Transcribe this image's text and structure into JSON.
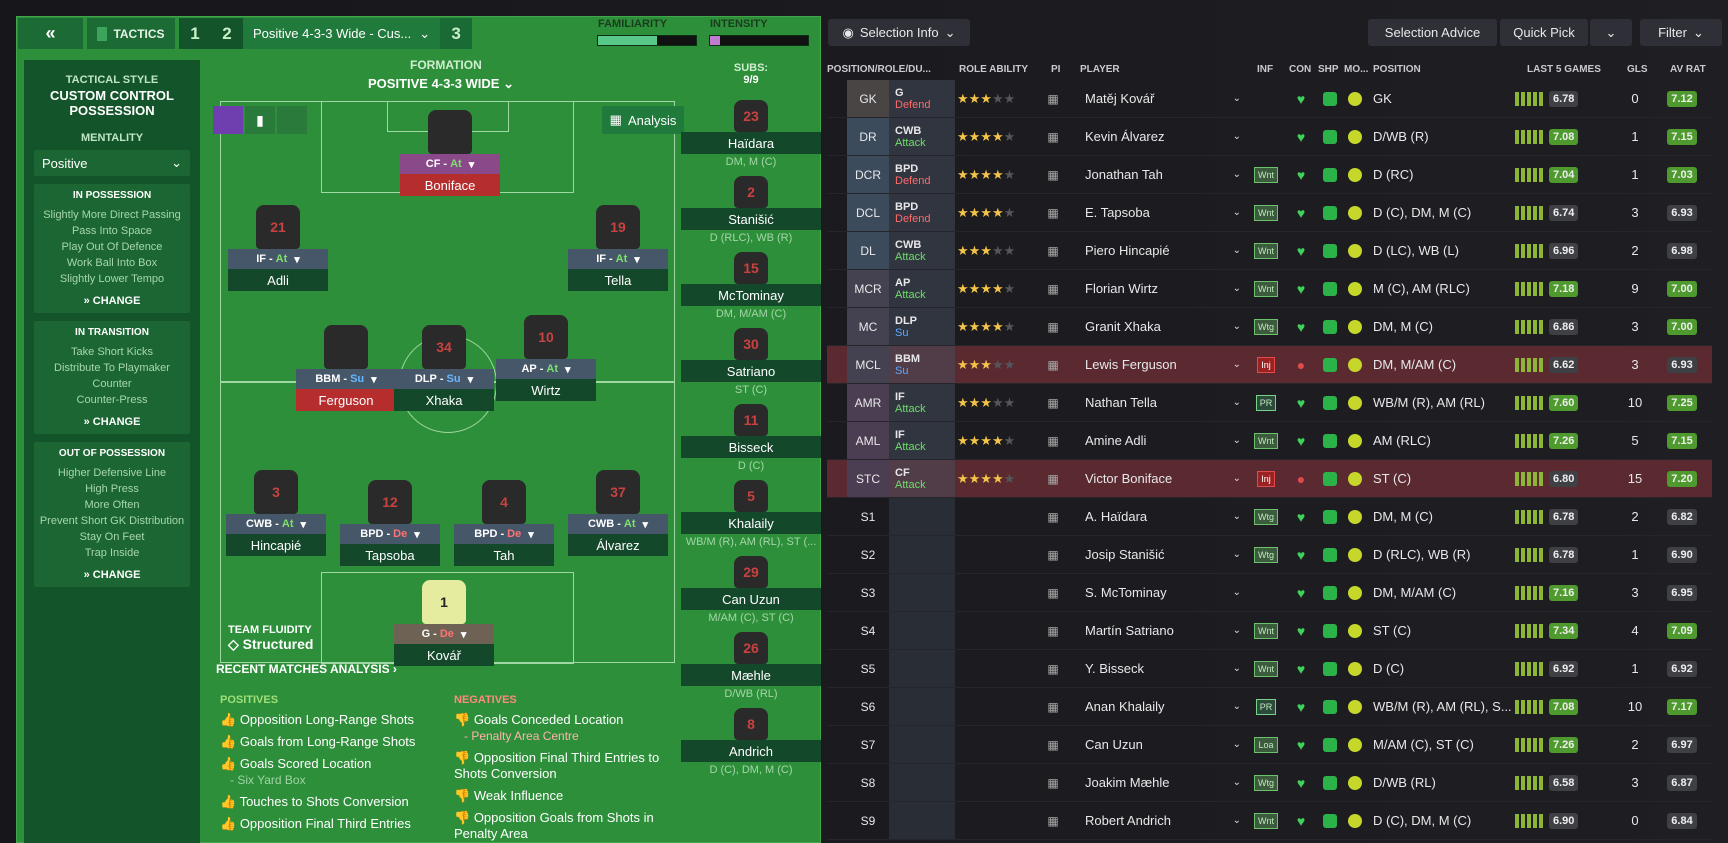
{
  "header": {
    "tactics_label": "TACTICS",
    "tab1": "1",
    "tab2": "2",
    "tab3": "3",
    "tactic_name": "Positive 4-3-3 Wide - Cus...",
    "familiarity": "FAMILIARITY",
    "intensity": "INTENSITY",
    "familiarity_level": 0.6,
    "intensity_level": 0.1
  },
  "left": {
    "tactical_style_heading": "TACTICAL STYLE",
    "tactical_style": "CUSTOM CONTROL POSSESSION",
    "mentality_heading": "MENTALITY",
    "mentality": "Positive",
    "in_possession": {
      "title": "IN POSSESSION",
      "items": [
        "Slightly More Direct Passing",
        "Pass Into Space",
        "Play Out Of Defence",
        "Work Ball Into Box",
        "Slightly Lower Tempo"
      ],
      "change": "CHANGE"
    },
    "in_transition": {
      "title": "IN TRANSITION",
      "items": [
        "Take Short Kicks",
        "Distribute To Playmaker",
        "Counter",
        "Counter-Press"
      ],
      "change": "CHANGE"
    },
    "out_of_possession": {
      "title": "OUT OF POSSESSION",
      "items": [
        "Higher Defensive Line",
        "High Press",
        "More Often",
        "Prevent Short GK Distribution",
        "Stay On Feet",
        "Trap Inside"
      ],
      "change": "CHANGE"
    }
  },
  "formation": {
    "heading": "FORMATION",
    "name": "POSITIVE 4-3-3 WIDE",
    "analysis_btn": "Analysis",
    "fluidity_heading": "TEAM FLUIDITY",
    "fluidity": "Structured"
  },
  "pitch_players": [
    {
      "num": "",
      "role": "CF",
      "duty": "At",
      "name": "Boniface",
      "inj": true,
      "gk": false
    },
    {
      "num": "21",
      "role": "IF",
      "duty": "At",
      "name": "Adli",
      "inj": false
    },
    {
      "num": "19",
      "role": "IF",
      "duty": "At",
      "name": "Tella",
      "inj": false
    },
    {
      "num": "",
      "role": "BBM",
      "duty": "Su",
      "name": "Ferguson",
      "inj": true
    },
    {
      "num": "34",
      "role": "DLP",
      "duty": "Su",
      "name": "Xhaka",
      "inj": false
    },
    {
      "num": "10",
      "role": "AP",
      "duty": "At",
      "name": "Wirtz",
      "inj": false
    },
    {
      "num": "3",
      "role": "CWB",
      "duty": "At",
      "name": "Hincapié",
      "inj": false
    },
    {
      "num": "12",
      "role": "BPD",
      "duty": "De",
      "name": "Tapsoba",
      "inj": false
    },
    {
      "num": "4",
      "role": "BPD",
      "duty": "De",
      "name": "Tah",
      "inj": false
    },
    {
      "num": "37",
      "role": "CWB",
      "duty": "At",
      "name": "Álvarez",
      "inj": false
    },
    {
      "num": "1",
      "role": "G",
      "duty": "De",
      "name": "Kovář",
      "inj": false
    }
  ],
  "subs": {
    "heading": "SUBS:",
    "count": "9/9",
    "list": [
      {
        "num": "23",
        "name": "Haïdara",
        "pos": "DM, M (C)"
      },
      {
        "num": "2",
        "name": "Stanišić",
        "pos": "D (RLC), WB (R)"
      },
      {
        "num": "15",
        "name": "McTominay",
        "pos": "DM, M/AM (C)"
      },
      {
        "num": "30",
        "name": "Satriano",
        "pos": "ST (C)"
      },
      {
        "num": "11",
        "name": "Bisseck",
        "pos": "D (C)"
      },
      {
        "num": "5",
        "name": "Khalaily",
        "pos": "WB/M (R), AM (RL), ST (..."
      },
      {
        "num": "29",
        "name": "Can Uzun",
        "pos": "M/AM (C), ST (C)"
      },
      {
        "num": "26",
        "name": "Mæhle",
        "pos": "D/WB (RL)"
      },
      {
        "num": "8",
        "name": "Andrich",
        "pos": "D (C), DM, M (C)"
      }
    ]
  },
  "analysis": {
    "heading": "RECENT MATCHES ANALYSIS",
    "positives_heading": "POSITIVES",
    "negatives_heading": "NEGATIVES",
    "positives": [
      "Opposition Long-Range Shots",
      "Goals from Long-Range Shots",
      "Goals Scored Location",
      "Touches to Shots Conversion",
      "Opposition Final Third Entries"
    ],
    "positive_sub": "- Six Yard Box",
    "negatives": [
      "Goals Conceded Location",
      "Opposition Final Third Entries to Shots Conversion",
      "Weak Influence",
      "Opposition Goals from Shots in Penalty Area"
    ],
    "negative_sub": "- Penalty Area Centre"
  },
  "right": {
    "selection_info": "Selection Info",
    "selection_advice": "Selection Advice",
    "quick_pick": "Quick Pick",
    "filter": "Filter",
    "columns": {
      "pos": "POSITION/ROLE/DU...",
      "ability": "ROLE ABILITY",
      "pi": "PI",
      "player": "PLAYER",
      "inf": "INF",
      "con": "CON",
      "shp": "SHP",
      "mo": "MO...",
      "position": "POSITION",
      "last5": "LAST 5 GAMES",
      "gls": "GLS",
      "avrat": "AV RAT"
    },
    "rows": [
      {
        "slot": "GK",
        "role": "G",
        "duty": "Defend",
        "stars": "2.5",
        "player": "Matěj Kovář",
        "inf": "",
        "position": "GK",
        "last": "6.78",
        "gls": "0",
        "av": "7.12"
      },
      {
        "slot": "DR",
        "role": "CWB",
        "duty": "Attack",
        "stars": "3.5",
        "player": "Kevin Álvarez",
        "inf": "",
        "position": "D/WB (R)",
        "last": "7.08",
        "gls": "1",
        "av": "7.15"
      },
      {
        "slot": "DCR",
        "role": "BPD",
        "duty": "Defend",
        "stars": "3.5",
        "player": "Jonathan Tah",
        "inf": "Wnt",
        "position": "D (RC)",
        "last": "7.04",
        "gls": "1",
        "av": "7.03"
      },
      {
        "slot": "DCL",
        "role": "BPD",
        "duty": "Defend",
        "stars": "3.5",
        "player": "E. Tapsoba",
        "inf": "Wnt",
        "position": "D (C), DM, M (C)",
        "last": "6.74",
        "gls": "3",
        "av": "6.93"
      },
      {
        "slot": "DL",
        "role": "CWB",
        "duty": "Attack",
        "stars": "2.5",
        "player": "Piero Hincapié",
        "inf": "Wnt",
        "position": "D (LC), WB (L)",
        "last": "6.96",
        "gls": "2",
        "av": "6.98"
      },
      {
        "slot": "MCR",
        "role": "AP",
        "duty": "Attack",
        "stars": "4",
        "player": "Florian Wirtz",
        "inf": "Wnt",
        "position": "M (C), AM (RLC)",
        "last": "7.18",
        "gls": "9",
        "av": "7.00"
      },
      {
        "slot": "MC",
        "role": "DLP",
        "duty": "Su",
        "stars": "3.5",
        "player": "Granit Xhaka",
        "inf": "Wtg",
        "position": "DM, M (C)",
        "last": "6.86",
        "gls": "3",
        "av": "7.00"
      },
      {
        "slot": "MCL",
        "role": "BBM",
        "duty": "Su",
        "stars": "3",
        "player": "Lewis Ferguson",
        "inf": "Inj",
        "position": "DM, M/AM (C)",
        "last": "6.62",
        "gls": "3",
        "av": "6.93"
      },
      {
        "slot": "AMR",
        "role": "IF",
        "duty": "Attack",
        "stars": "3",
        "player": "Nathan Tella",
        "inf": "PR",
        "position": "WB/M (R), AM (RL)",
        "last": "7.60",
        "gls": "10",
        "av": "7.25"
      },
      {
        "slot": "AML",
        "role": "IF",
        "duty": "Attack",
        "stars": "3.5",
        "player": "Amine Adli",
        "inf": "Wnt",
        "position": "AM (RLC)",
        "last": "7.26",
        "gls": "5",
        "av": "7.15"
      },
      {
        "slot": "STC",
        "role": "CF",
        "duty": "Attack",
        "stars": "4",
        "player": "Victor Boniface",
        "inf": "Inj",
        "position": "ST (C)",
        "last": "6.80",
        "gls": "15",
        "av": "7.20"
      },
      {
        "slot": "S1",
        "role": "",
        "duty": "",
        "stars": "",
        "player": "A. Haïdara",
        "inf": "Wtg",
        "position": "DM, M (C)",
        "last": "6.78",
        "gls": "2",
        "av": "6.82"
      },
      {
        "slot": "S2",
        "role": "",
        "duty": "",
        "stars": "",
        "player": "Josip Stanišić",
        "inf": "Wtg",
        "position": "D (RLC), WB (R)",
        "last": "6.78",
        "gls": "1",
        "av": "6.90"
      },
      {
        "slot": "S3",
        "role": "",
        "duty": "",
        "stars": "",
        "player": "S. McTominay",
        "inf": "",
        "position": "DM, M/AM (C)",
        "last": "7.16",
        "gls": "3",
        "av": "6.95"
      },
      {
        "slot": "S4",
        "role": "",
        "duty": "",
        "stars": "",
        "player": "Martín Satriano",
        "inf": "Wnt",
        "position": "ST (C)",
        "last": "7.34",
        "gls": "4",
        "av": "7.09"
      },
      {
        "slot": "S5",
        "role": "",
        "duty": "",
        "stars": "",
        "player": "Y. Bisseck",
        "inf": "Wnt",
        "position": "D (C)",
        "last": "6.92",
        "gls": "1",
        "av": "6.92"
      },
      {
        "slot": "S6",
        "role": "",
        "duty": "",
        "stars": "",
        "player": "Anan Khalaily",
        "inf": "PR",
        "position": "WB/M (R), AM (RL), S...",
        "last": "7.08",
        "gls": "10",
        "av": "7.17"
      },
      {
        "slot": "S7",
        "role": "",
        "duty": "",
        "stars": "",
        "player": "Can Uzun",
        "inf": "Loa",
        "position": "M/AM (C), ST (C)",
        "last": "7.26",
        "gls": "2",
        "av": "6.97"
      },
      {
        "slot": "S8",
        "role": "",
        "duty": "",
        "stars": "",
        "player": "Joakim Mæhle",
        "inf": "Wtg",
        "position": "D/WB (RL)",
        "last": "6.58",
        "gls": "3",
        "av": "6.87"
      },
      {
        "slot": "S9",
        "role": "",
        "duty": "",
        "stars": "",
        "player": "Robert Andrich",
        "inf": "Wnt",
        "position": "D (C), DM, M (C)",
        "last": "6.90",
        "gls": "0",
        "av": "6.84"
      }
    ]
  }
}
